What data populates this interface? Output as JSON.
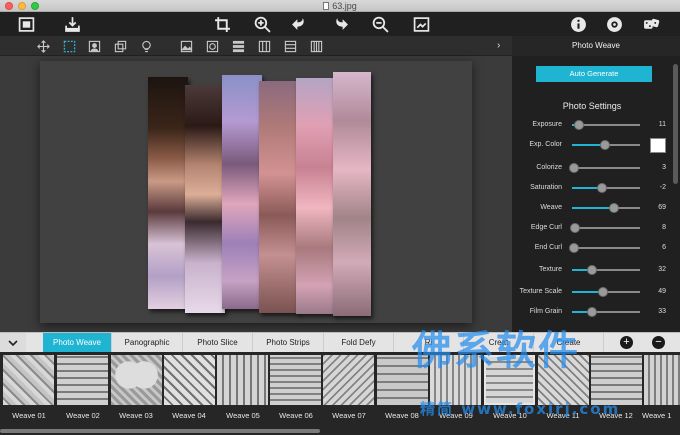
{
  "window": {
    "title": "63.jpg"
  },
  "toolbar": {
    "icons": [
      "image-frame-icon",
      "import-icon",
      "crop-icon",
      "zoom-in-icon",
      "undo-icon",
      "redo-icon",
      "zoom-out-icon",
      "fit-screen-icon",
      "info-icon",
      "settings-icon",
      "dice-icon"
    ]
  },
  "tools": {
    "icons": [
      "move-icon",
      "select-icon",
      "portrait-icon",
      "layers-icon",
      "bulb-icon",
      "image-icon",
      "circle-frame-icon",
      "horizontal-split-icon",
      "vertical-split-icon",
      "rows-icon",
      "columns-icon"
    ],
    "active_index": 1
  },
  "panel": {
    "title": "Photo Weave",
    "auto_generate_label": "Auto Generate",
    "settings_title": "Photo Settings",
    "settings": [
      {
        "label": "Exposure",
        "value": "11",
        "level": 0.11
      },
      {
        "label": "Exp. Color",
        "value": "",
        "level": 0.48,
        "swatch": "#ffffff"
      },
      {
        "label": "Colorize",
        "value": "3",
        "level": 0.03
      },
      {
        "label": "Saturation",
        "value": "-2",
        "level": 0.44
      },
      {
        "label": "Weave",
        "value": "69",
        "level": 0.62
      },
      {
        "label": "Edge Curl",
        "value": "8",
        "level": 0.04
      },
      {
        "label": "End Curl",
        "value": "6",
        "level": 0.03
      },
      {
        "label": "Texture",
        "value": "32",
        "level": 0.3
      },
      {
        "label": "Texture Scale",
        "value": "49",
        "level": 0.46
      },
      {
        "label": "Film Grain",
        "value": "33",
        "level": 0.3
      }
    ]
  },
  "tabs": {
    "items": [
      "Photo Weave",
      "Panographic",
      "Photo Slice",
      "Photo Strips",
      "Fold Defy",
      "Ri",
      "Creat",
      "Create"
    ],
    "active_index": 0,
    "add_label": "+",
    "remove_label": "−"
  },
  "thumbnails": {
    "items": [
      "Weave 01",
      "Weave 02",
      "Weave 03",
      "Weave 04",
      "Weave 05",
      "Weave 06",
      "Weave 07",
      "Weave 08",
      "Weave 09",
      "Weave 10",
      "Weave 11",
      "Weave 12",
      "Weave 1"
    ],
    "selected_index": 9
  },
  "watermark": {
    "main": "佛系软件",
    "sub": "精简 www.foxirj.com"
  },
  "colors": {
    "accent": "#1fb4d2",
    "toolbar": "#202020",
    "panel": "#202020",
    "canvas": "#3b3b3b"
  }
}
